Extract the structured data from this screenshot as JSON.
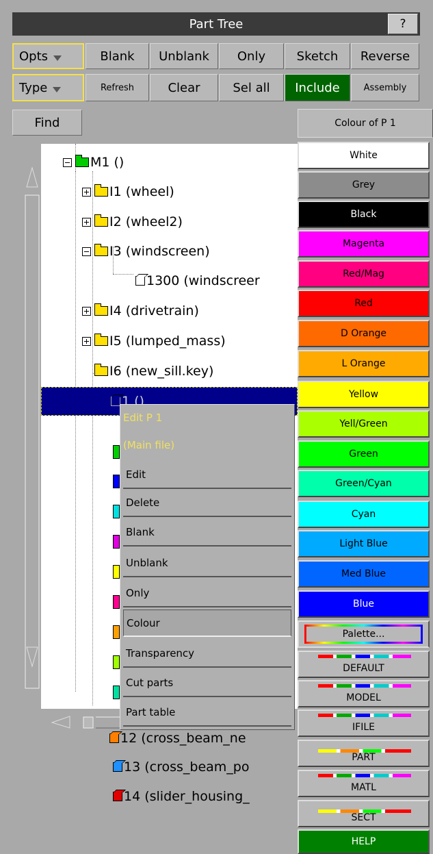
{
  "title": "Part Tree",
  "help_btn": "?",
  "toolbar": {
    "row1": [
      "Opts",
      "Blank",
      "Unblank",
      "Only",
      "Sketch",
      "Reverse"
    ],
    "row2": [
      "Type",
      "Refresh",
      "Clear",
      "Sel all",
      "Include",
      "Assembly"
    ],
    "find": "Find"
  },
  "tree": {
    "items": [
      {
        "label": "M1 ()",
        "icon": "folder",
        "color": "#00cc00"
      },
      {
        "label": "I1 (wheel)",
        "icon": "folder",
        "color": "#ffe000"
      },
      {
        "label": "I2 (wheel2)",
        "icon": "folder",
        "color": "#ffe000"
      },
      {
        "label": "I3 (windscreen)",
        "icon": "folder",
        "color": "#ffe000"
      },
      {
        "label": "1300 (windscreer",
        "icon": "cube",
        "color": "#ffffff"
      },
      {
        "label": "I4 (drivetrain)",
        "icon": "folder",
        "color": "#ffe000"
      },
      {
        "label": "I5 (lumped_mass)",
        "icon": "folder",
        "color": "#ffe000"
      },
      {
        "label": "I6 (new_sill.key)",
        "icon": "folder",
        "color": "#ffe000"
      },
      {
        "label": "1 ()",
        "icon": "cube",
        "color": "#00008b"
      },
      {
        "label": "12 (cross_beam_ne",
        "icon": "cube",
        "color": "#ff8000"
      },
      {
        "label": "13 (cross_beam_po",
        "icon": "cube",
        "color": "#1e90ff"
      },
      {
        "label": "14 (slider_housing_",
        "icon": "cube",
        "color": "#e00000"
      }
    ]
  },
  "context_menu": {
    "header1": "Edit P 1",
    "header2": "(Main file)",
    "items": [
      "Edit",
      "Delete",
      "Blank",
      "Unblank",
      "Only",
      "Colour",
      "Transparency",
      "Cut parts",
      "Part table"
    ]
  },
  "colour_panel": {
    "title": "Colour of P 1",
    "colors": [
      {
        "name": "White",
        "bg": "#ffffff",
        "fg": "#000000"
      },
      {
        "name": "Grey",
        "bg": "#8c8c8c",
        "fg": "#000000"
      },
      {
        "name": "Black",
        "bg": "#000000",
        "fg": "#ffffff"
      },
      {
        "name": "Magenta",
        "bg": "#ff00ff",
        "fg": "#000000"
      },
      {
        "name": "Red/Mag",
        "bg": "#ff0080",
        "fg": "#000000"
      },
      {
        "name": "Red",
        "bg": "#ff0000",
        "fg": "#000000"
      },
      {
        "name": "D Orange",
        "bg": "#ff6a00",
        "fg": "#000000"
      },
      {
        "name": "L Orange",
        "bg": "#ffaa00",
        "fg": "#000000"
      },
      {
        "name": "Yellow",
        "bg": "#ffff00",
        "fg": "#000000"
      },
      {
        "name": "Yell/Green",
        "bg": "#aaff00",
        "fg": "#000000"
      },
      {
        "name": "Green",
        "bg": "#00ff00",
        "fg": "#000000"
      },
      {
        "name": "Green/Cyan",
        "bg": "#00ffaa",
        "fg": "#000000"
      },
      {
        "name": "Cyan",
        "bg": "#00ffff",
        "fg": "#000000"
      },
      {
        "name": "Light Blue",
        "bg": "#00aaff",
        "fg": "#000000"
      },
      {
        "name": "Med Blue",
        "bg": "#0066ff",
        "fg": "#000000"
      },
      {
        "name": "Blue",
        "bg": "#0000ff",
        "fg": "#ffffff"
      }
    ],
    "palette": "Palette...",
    "specials": [
      "DEFAULT",
      "MODEL",
      "IFILE",
      "PART",
      "MATL",
      "SECT"
    ],
    "help": "HELP"
  }
}
